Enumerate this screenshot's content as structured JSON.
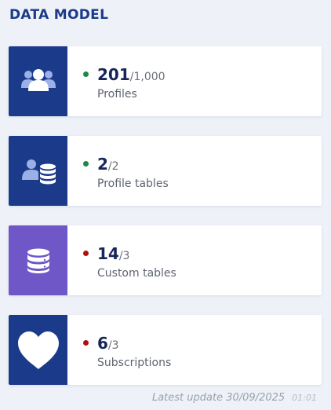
{
  "section_title": "DATA MODEL",
  "colors": {
    "navy": "#1c3a8a",
    "purple": "#6f57c8",
    "ok": "#1a8a45",
    "over": "#b00f0f"
  },
  "cards": [
    {
      "value": "201",
      "limit": "/1,000",
      "label": "Profiles",
      "icon": "profiles-icon",
      "status": "ok"
    },
    {
      "value": "2",
      "limit": "/2",
      "label": "Profile tables",
      "icon": "profile-tables-icon",
      "status": "ok"
    },
    {
      "value": "14",
      "limit": "/3",
      "label": "Custom tables",
      "icon": "database-icon",
      "status": "over"
    },
    {
      "value": "6",
      "limit": "/3",
      "label": "Subscriptions",
      "icon": "heart-icon",
      "status": "over"
    }
  ],
  "footer": {
    "label": "Latest update",
    "date": "30/09/2025",
    "time": "01:01"
  }
}
